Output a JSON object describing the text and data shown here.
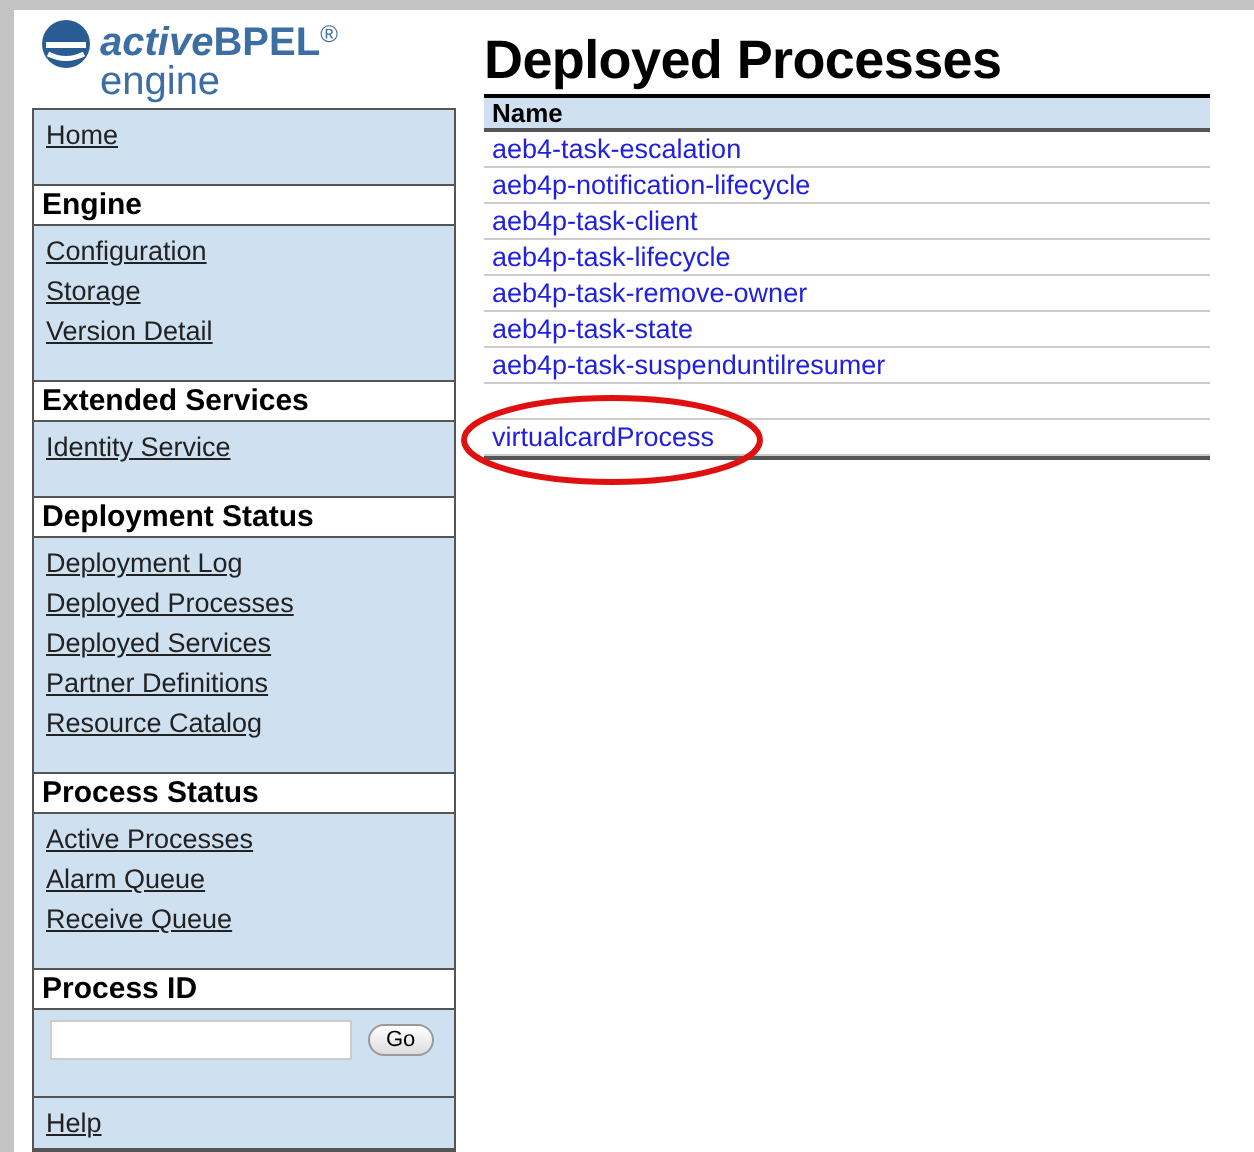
{
  "logo": {
    "brand_italic": "active",
    "brand": "BPEL",
    "mark": "®",
    "product": "engine"
  },
  "sidebar": [
    {
      "kind": "links",
      "items": [
        "Home"
      ]
    },
    {
      "kind": "section",
      "title": "Engine",
      "items": [
        "Configuration",
        "Storage",
        "Version Detail"
      ]
    },
    {
      "kind": "section",
      "title": "Extended Services",
      "items": [
        "Identity Service"
      ]
    },
    {
      "kind": "section",
      "title": "Deployment Status",
      "items": [
        "Deployment Log",
        "Deployed Processes",
        "Deployed Services",
        "Partner Definitions",
        "Resource Catalog"
      ]
    },
    {
      "kind": "section",
      "title": "Process Status",
      "items": [
        "Active Processes",
        "Alarm Queue",
        "Receive Queue"
      ]
    },
    {
      "kind": "form",
      "title": "Process ID",
      "button": "Go"
    },
    {
      "kind": "links",
      "items": [
        "Help"
      ]
    }
  ],
  "page_title": "Deployed Processes",
  "table": {
    "columns": [
      "Name"
    ],
    "rows": [
      {
        "kind": "link",
        "name": "aeb4-task-escalation"
      },
      {
        "kind": "link",
        "name": "aeb4p-notification-lifecycle"
      },
      {
        "kind": "link",
        "name": "aeb4p-task-client"
      },
      {
        "kind": "link",
        "name": "aeb4p-task-lifecycle"
      },
      {
        "kind": "link",
        "name": "aeb4p-task-remove-owner"
      },
      {
        "kind": "link",
        "name": "aeb4p-task-state"
      },
      {
        "kind": "link",
        "name": "aeb4p-task-suspenduntilresumer"
      },
      {
        "kind": "hidden"
      },
      {
        "kind": "link",
        "name": "virtualcardProcess",
        "circled": true
      }
    ]
  }
}
